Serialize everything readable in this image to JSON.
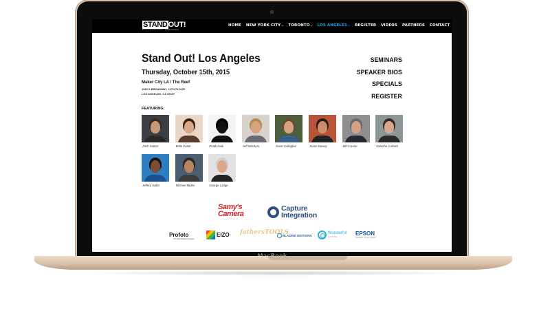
{
  "device": {
    "label": "MacBook"
  },
  "header": {
    "logo": {
      "text_boxed": "STAND",
      "text_rest": "OUT!",
      "tagline": "PHOTOGRAPHIC SEMINARS"
    },
    "nav": [
      {
        "label": "HOME",
        "has_dropdown": false,
        "active": false
      },
      {
        "label": "NEW YORK CITY",
        "has_dropdown": true,
        "active": false
      },
      {
        "label": "TORONTO",
        "has_dropdown": true,
        "active": false
      },
      {
        "label": "LOS ANGELES",
        "has_dropdown": true,
        "active": true
      },
      {
        "label": "REGISTER",
        "has_dropdown": false,
        "active": false
      },
      {
        "label": "VIDEOS",
        "has_dropdown": false,
        "active": false
      },
      {
        "label": "PARTNERS",
        "has_dropdown": false,
        "active": false
      },
      {
        "label": "CONTACT",
        "has_dropdown": false,
        "active": false
      }
    ],
    "active_color": "#1aa7e3"
  },
  "event": {
    "title": "Stand Out! Los Angeles",
    "date": "Thursday, October 15th, 2015",
    "venue": "Maker City LA / The Reef",
    "address_line1": "1933 S BROADWAY, 11TH FLOOR",
    "address_line2": "LOS ANGELES, CA 90007"
  },
  "side_menu": [
    "SEMINARS",
    "SPEAKER BIOS",
    "SPECIALS",
    "REGISTER"
  ],
  "featuring_label": "FEATURING:",
  "speakers": [
    {
      "name": "Zach Sutton",
      "skin": "#c79a7c",
      "hair": "#3a2a22",
      "bg": "#3b3f45",
      "shirt": "#2a2a2a"
    },
    {
      "name": "Bella Kotak",
      "skin": "#d9a98a",
      "hair": "#3b2418",
      "bg": "#e9d6c4",
      "shirt": "#5a3a2a"
    },
    {
      "name": "Pratik Naik",
      "skin": "#111111",
      "hair": "#000000",
      "bg": "#f4f4f4",
      "shirt": "#111111"
    },
    {
      "name": "Jeff Mitchum",
      "skin": "#d8a37f",
      "hair": "#b88a5a",
      "bg": "#d8d2cc",
      "shirt": "#6a6a74"
    },
    {
      "name": "Dave Gallagher",
      "skin": "#d6a283",
      "hair": "#6b4a32",
      "bg": "#4d5e3c",
      "shirt": "#3b5f8c"
    },
    {
      "name": "Jason Dewey",
      "skin": "#c88d6a",
      "hair": "#2d1c12",
      "bg": "#b9533a",
      "shirt": "#222222"
    },
    {
      "name": "Bill Cramer",
      "skin": "#d5a184",
      "hair": "#6a6a6a",
      "bg": "#8f8f8f",
      "shirt": "#262a33"
    },
    {
      "name": "Natasha Calzatti",
      "skin": "#d9a78c",
      "hair": "#3b2a22",
      "bg": "#8c9696",
      "shirt": "#2a2a2a"
    },
    {
      "name": "Jeffery Salter",
      "skin": "#7a4e34",
      "hair": "#1c120c",
      "bg": "#2e7cc2",
      "shirt": "#1d4f8c"
    },
    {
      "name": "Michael Muller",
      "skin": "#b7865f",
      "hair": "#2a2a2a",
      "bg": "#4b5d6f",
      "shirt": "#3b3b3b"
    },
    {
      "name": "George Lange",
      "skin": "#d9a98a",
      "hair": "#cfcfcf",
      "bg": "#e2e2e2",
      "shirt": "#222222"
    }
  ],
  "sponsors": {
    "samys": {
      "line1": "Samy's",
      "line2": "Camera",
      "color": "#d2232a"
    },
    "capture": {
      "line1": "Capture",
      "line2": "Integration",
      "color": "#2f4d82"
    },
    "profoto": {
      "name": "Profoto",
      "tagline": "The Light Shaping Company"
    },
    "eizo": {
      "name": "EIZO"
    },
    "fatherstools": {
      "line1": "fathers",
      "line2": "TOOLS"
    },
    "blazing": {
      "name": "BLAZING EDITIONS"
    },
    "wonderful": {
      "name": "Wonderful",
      "sub": "MACHINE"
    },
    "epson": {
      "name": "EPSON",
      "tagline": "EXCEED YOUR VISION"
    }
  }
}
